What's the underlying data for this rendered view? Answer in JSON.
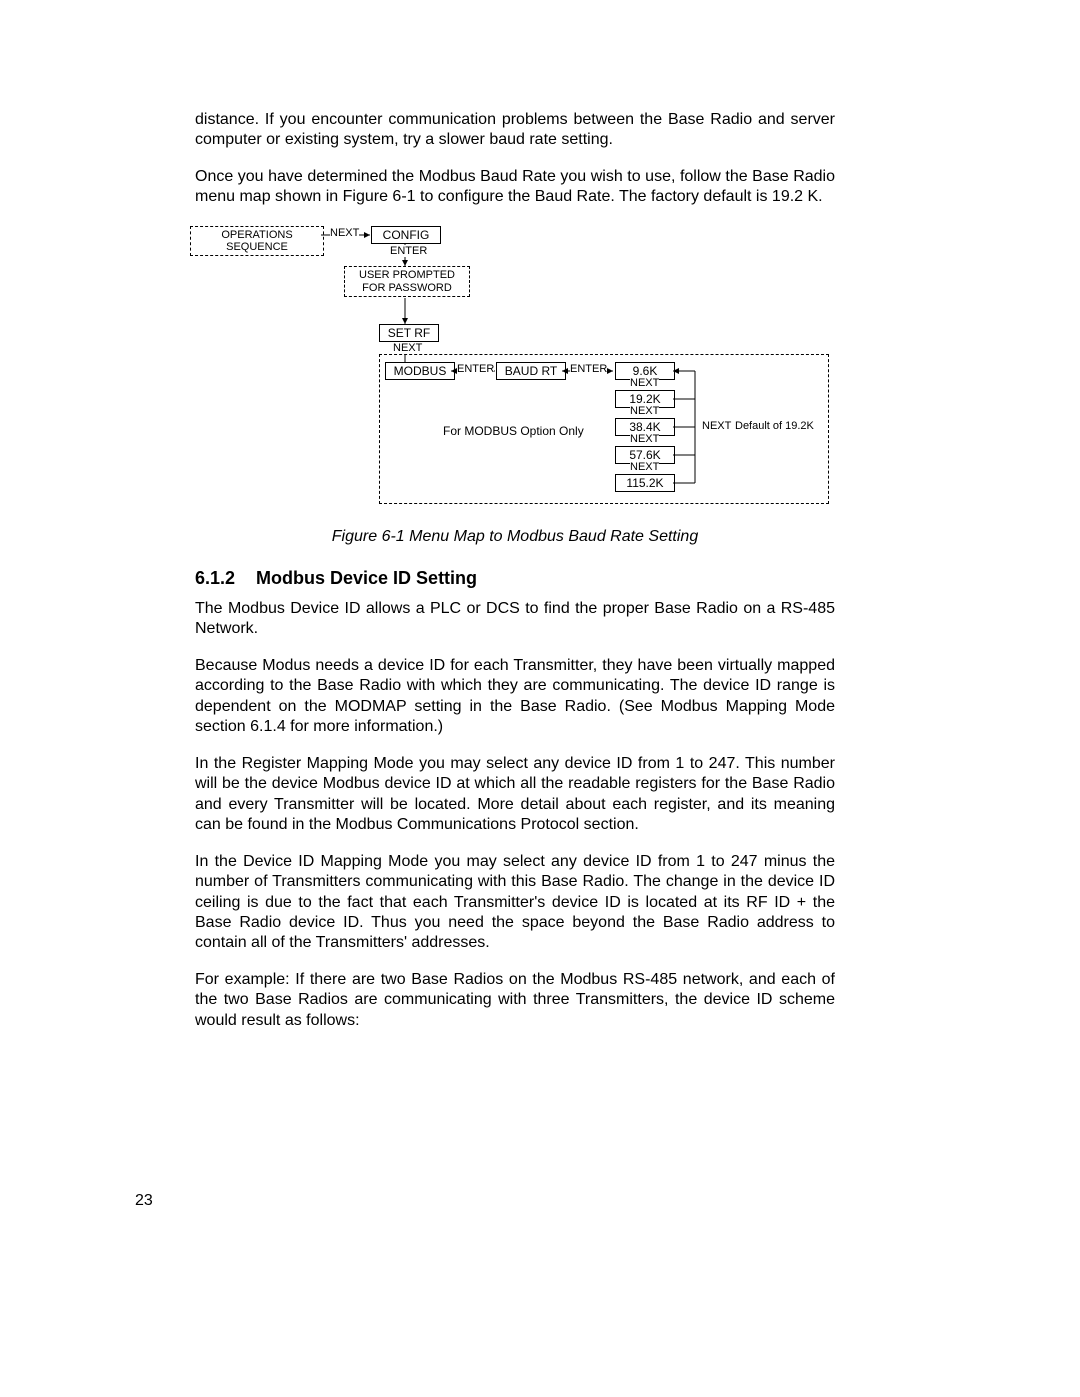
{
  "paragraphs": {
    "p1": "distance. If you encounter communication problems between the Base Radio and server computer or existing system, try a slower baud rate setting.",
    "p2": "Once you have determined the Modbus Baud Rate you wish to use, follow the Base Radio menu map shown in Figure 6-1 to configure the Baud Rate. The factory default is 19.2 K.",
    "caption": "Figure 6-1 Menu Map to Modbus Baud Rate Setting",
    "heading_num": "6.1.2",
    "heading_text": "Modbus Device ID Setting",
    "p3": "The Modbus Device ID allows a PLC or DCS to find the proper Base Radio on a RS-485 Network.",
    "p4": "Because Modus needs a device ID for each Transmitter, they have been virtually mapped according to the Base Radio with which they are communicating. The device ID range is dependent on the MODMAP setting in the Base Radio. (See Modbus Mapping Mode section 6.1.4 for more information.)",
    "p5": "In the Register Mapping Mode you may select any device ID from 1 to 247. This number will be the device Modbus device ID at which all the readable registers for the Base Radio and every Transmitter will be located. More detail about each register, and its meaning can be found in the Modbus Communications Protocol section.",
    "p6": "In the Device ID Mapping Mode you may select any device ID from 1 to 247 minus the number of Transmitters communicating with this Base Radio. The change in the device ID ceiling is due to the fact that each Transmitter's device ID is located at its RF ID + the Base Radio device ID. Thus you need the space beyond the Base Radio address to contain all of the Transmitters' addresses.",
    "p7": "For example: If there are two Base Radios on the Modbus RS-485 network, and each of the two Base Radios are communicating with three Transmitters, the device ID scheme would result as follows:"
  },
  "diagram": {
    "operations_sequence": "OPERATIONS SEQUENCE",
    "next": "NEXT",
    "config": "CONFIG",
    "enter": "ENTER",
    "user_prompted": "USER PROMPTED FOR PASSWORD",
    "set_rf": "SET RF",
    "modbus": "MODBUS",
    "baud_rt": "BAUD RT",
    "rates": {
      "r1": "9.6K",
      "r2": "19.2K",
      "r3": "38.4K",
      "r4": "57.6K",
      "r5": "115.2K"
    },
    "modbus_option": "For MODBUS Option Only",
    "default": "Default of 19.2K"
  },
  "page_number": "23"
}
